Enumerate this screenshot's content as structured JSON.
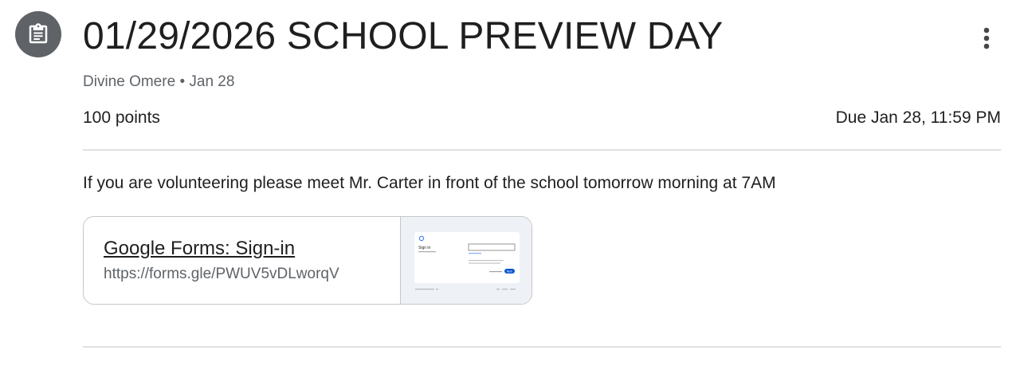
{
  "assignment": {
    "icon": "assignment-icon",
    "title": "01/29/2026 SCHOOL PREVIEW DAY",
    "author": "Divine Omere",
    "separator": "•",
    "posted_date": "Jan 28",
    "points": "100 points",
    "due": "Due Jan 28, 11:59 PM",
    "more_icon": "more-vert-icon",
    "description": "If you are volunteering please meet Mr. Carter in front of the school tomorrow morning at 7AM"
  },
  "attachment": {
    "title": "Google Forms: Sign-in",
    "url": "https://forms.gle/PWUV5vDLworqV",
    "thumbnail": {
      "heading": "Sign in",
      "button": "Next"
    }
  },
  "colors": {
    "icon_bg": "#5f6368",
    "divider": "#e0e0e0",
    "secondary_text": "#5f6368",
    "accent": "#0b57d0"
  }
}
